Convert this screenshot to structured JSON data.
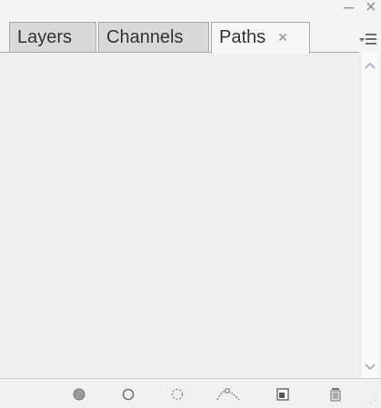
{
  "tabs": [
    {
      "label": "Layers"
    },
    {
      "label": "Channels"
    },
    {
      "label": "Paths",
      "close": "×"
    }
  ],
  "window_controls": {
    "minimize": "–",
    "close": "×"
  },
  "bottom_icons": [
    "fill-path-icon",
    "stroke-path-icon",
    "load-path-as-selection-icon",
    "make-work-path-icon",
    "create-new-path-icon",
    "delete-path-icon"
  ]
}
